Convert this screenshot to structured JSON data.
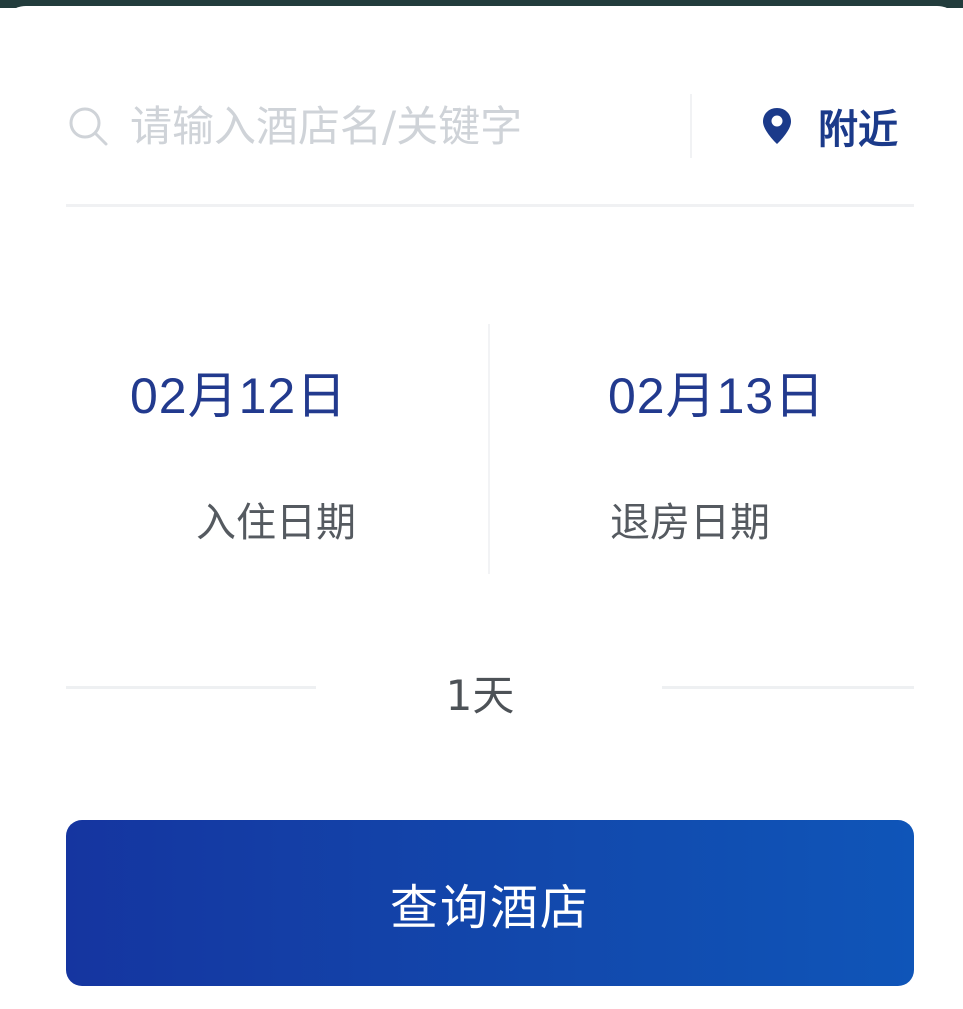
{
  "search": {
    "placeholder": "请输入酒店名/关键字",
    "nearby_label": "附近"
  },
  "dates": {
    "checkin": {
      "value": "02月12日",
      "label": "入住日期"
    },
    "checkout": {
      "value": "02月13日",
      "label": "退房日期"
    }
  },
  "nights": {
    "text": "1天"
  },
  "actions": {
    "search_hotel_label": "查询酒店"
  },
  "icons": {
    "search": "search-icon",
    "location": "location-pin-icon"
  },
  "colors": {
    "accent": "#1b3a8a",
    "button": "#1248ac",
    "placeholder": "#cfd3d8"
  }
}
